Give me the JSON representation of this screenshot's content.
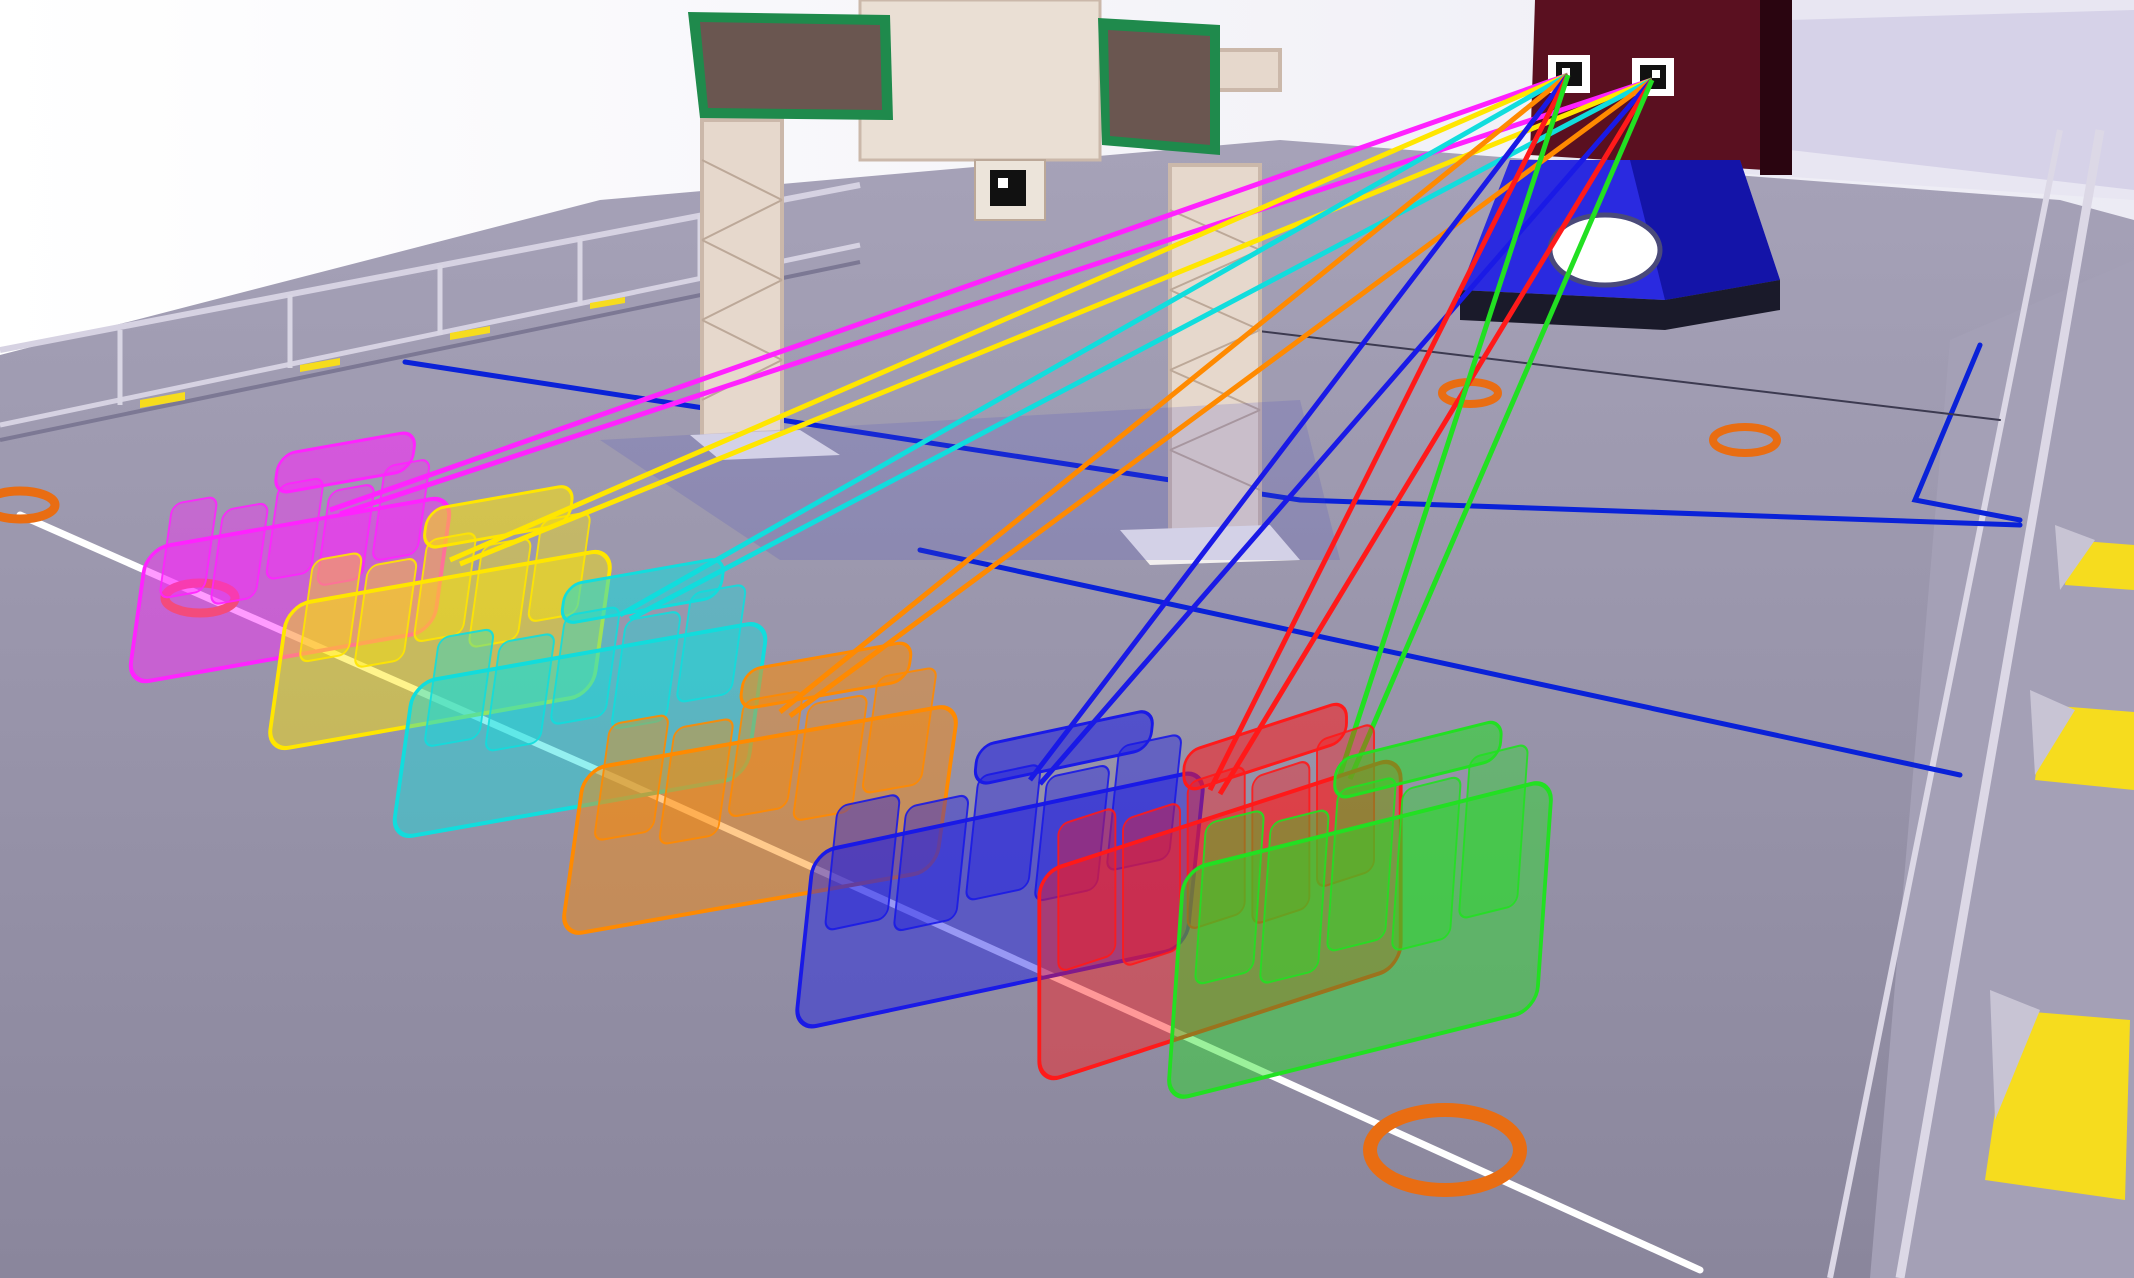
{
  "scene": {
    "colors": {
      "sky": "#ffffff",
      "far_wall": "#f4f2fa",
      "floor": "#8e8aa0",
      "floor_light": "#a9a5ba",
      "rail": "#d9d6e4",
      "hazard_yellow": "#f6dc1e",
      "ring_orange": "#e96d12",
      "field_line_blue": "#0a22d8",
      "field_line_white": "#ffffff",
      "truss": "#d9c9bc",
      "screen_body": "#6a5650",
      "screen_frame": "#1f8a4c",
      "hub_dark": "#5a1020",
      "hub_blue": "#2a2ae0"
    },
    "robots": [
      {
        "name": "magenta",
        "color": "#ff22ff"
      },
      {
        "name": "yellow",
        "color": "#ffe600"
      },
      {
        "name": "cyan",
        "color": "#11dddd"
      },
      {
        "name": "orange",
        "color": "#ff8a00"
      },
      {
        "name": "blue",
        "color": "#1a1ae6"
      },
      {
        "name": "red",
        "color": "#ff1a1a"
      },
      {
        "name": "green",
        "color": "#22e022"
      }
    ],
    "markers": [
      {
        "name": "marker-left"
      },
      {
        "name": "marker-right"
      }
    ]
  }
}
